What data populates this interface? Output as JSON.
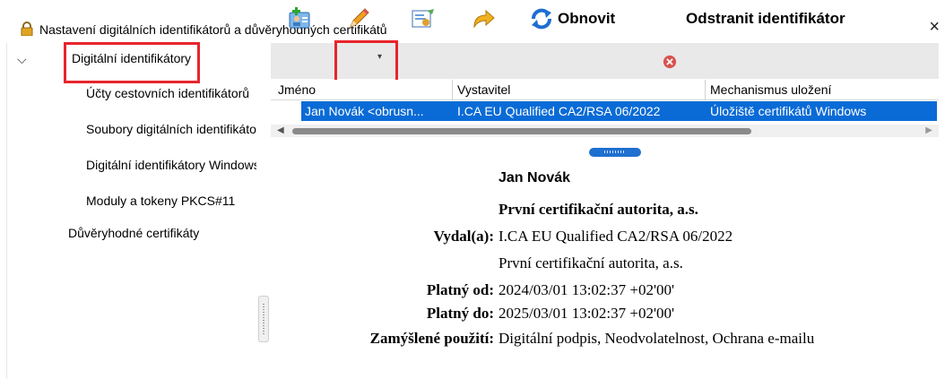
{
  "window": {
    "title": "Nastavení digitálních identifikátorů a důvěryhodných certifikátů",
    "close_symbol": "×"
  },
  "sidebar": {
    "items": [
      {
        "label": "Digitální identifikátory",
        "selected": true
      },
      {
        "label": "Účty cestovních identifikátorů"
      },
      {
        "label": "Soubory digitálních identifikátorů"
      },
      {
        "label": "Digitální identifikátory Windows"
      },
      {
        "label": "Moduly a tokeny PKCS#11"
      },
      {
        "label": "Důvěryhodné certifikáty"
      }
    ]
  },
  "toolbar": {
    "icons": [
      "add-id-icon",
      "pencil-icon",
      "certificate-icon",
      "export-arrow-icon"
    ],
    "refresh_label": "Obnovit",
    "remove_label": "Odstranit identifikátor"
  },
  "table": {
    "columns": [
      "Jméno",
      "Vystavitel",
      "Mechanismus uložení"
    ],
    "rows": [
      {
        "name": "Jan Novák  <obrusn...",
        "issuer": "I.CA EU Qualified CA2/RSA 06/2022",
        "storage": "Úložiště certifikátů Windows"
      }
    ]
  },
  "detail": {
    "name": "Jan Novák",
    "org": "První certifikační autorita, a.s.",
    "issued_by_label": "Vydal(a):",
    "issued_by_value": "I.CA EU Qualified CA2/RSA 06/2022",
    "issued_by_org": "První certifikační autorita, a.s.",
    "valid_from_label": "Platný od:",
    "valid_from_value": "2024/03/01 13:02:37 +02'00'",
    "valid_to_label": "Platný do:",
    "valid_to_value": "2025/03/01 13:02:37 +02'00'",
    "intended_use_label": "Zamýšlené použití:",
    "intended_use_value": "Digitální podpis, Neodvolatelnost, Ochrana e-mailu"
  },
  "colors": {
    "highlight_box": "#e8242c",
    "selection": "#0a6bd6",
    "toolbar_bg": "#e9e9e9"
  }
}
